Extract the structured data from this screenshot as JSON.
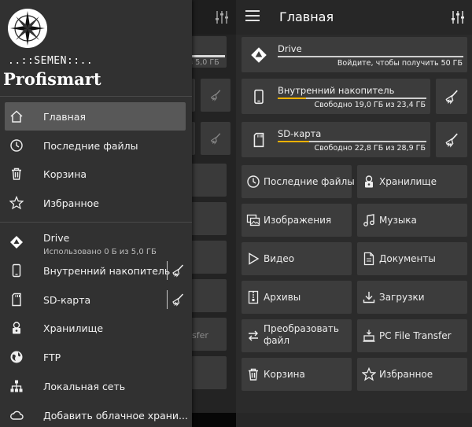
{
  "drawer": {
    "brand_line1": "..::SEMEN::..",
    "brand_line2": "Profismart",
    "nav": [
      {
        "label": "Главная",
        "icon": "home-icon"
      },
      {
        "label": "Последние файлы",
        "icon": "clock-icon"
      },
      {
        "label": "Корзина",
        "icon": "trash-icon"
      },
      {
        "label": "Избранное",
        "icon": "star-icon"
      }
    ],
    "storage": {
      "drive": {
        "label": "Drive",
        "sub": "Использовано 0 Б  из 5,0 ГБ"
      },
      "internal": {
        "label": "Внутренний накопитель"
      },
      "sd": {
        "label": "SD-карта"
      }
    },
    "more": [
      {
        "label": "Хранилище",
        "icon": "vault-icon"
      },
      {
        "label": "FTP",
        "icon": "globe-icon"
      },
      {
        "label": "Локальная сеть",
        "icon": "network-icon"
      },
      {
        "label": "Добавить облачное храни...",
        "icon": "cloud-icon"
      }
    ]
  },
  "background": {
    "drive_partial": "из 5,0 ГБ",
    "transfer_partial": "sfer"
  },
  "main": {
    "title": "Главная",
    "storage": {
      "drive": {
        "name": "Drive",
        "info": "Войдите, чтобы получить 50 ГБ",
        "fill": 0.0
      },
      "internal": {
        "name": "Внутренний накопитель",
        "info": "Свободно 19,0 ГБ из 23,4 ГБ",
        "fill": 0.19
      },
      "sd": {
        "name": "SD-карта",
        "info": "Свободно 22,8 ГБ из 28,9 ГБ",
        "fill": 0.21
      }
    },
    "tiles": [
      {
        "label": "Последние файлы",
        "icon": "clock-icon"
      },
      {
        "label": "Хранилище",
        "icon": "vault-icon"
      },
      {
        "label": "Изображения",
        "icon": "images-icon"
      },
      {
        "label": "Музыка",
        "icon": "music-icon"
      },
      {
        "label": "Видео",
        "icon": "video-icon"
      },
      {
        "label": "Документы",
        "icon": "document-icon"
      },
      {
        "label": "Архивы",
        "icon": "archive-icon"
      },
      {
        "label": "Загрузки",
        "icon": "download-icon"
      },
      {
        "label": "Преобразовать файл",
        "icon": "convert-icon"
      },
      {
        "label": "PC File Transfer",
        "icon": "pc-transfer-icon"
      },
      {
        "label": "Корзина",
        "icon": "trash-icon"
      },
      {
        "label": "Избранное",
        "icon": "star-icon"
      }
    ]
  },
  "colors": {
    "accent": "#f2b100",
    "card": "#3c3c3c",
    "drawer": "#313131",
    "active": "#585858"
  }
}
